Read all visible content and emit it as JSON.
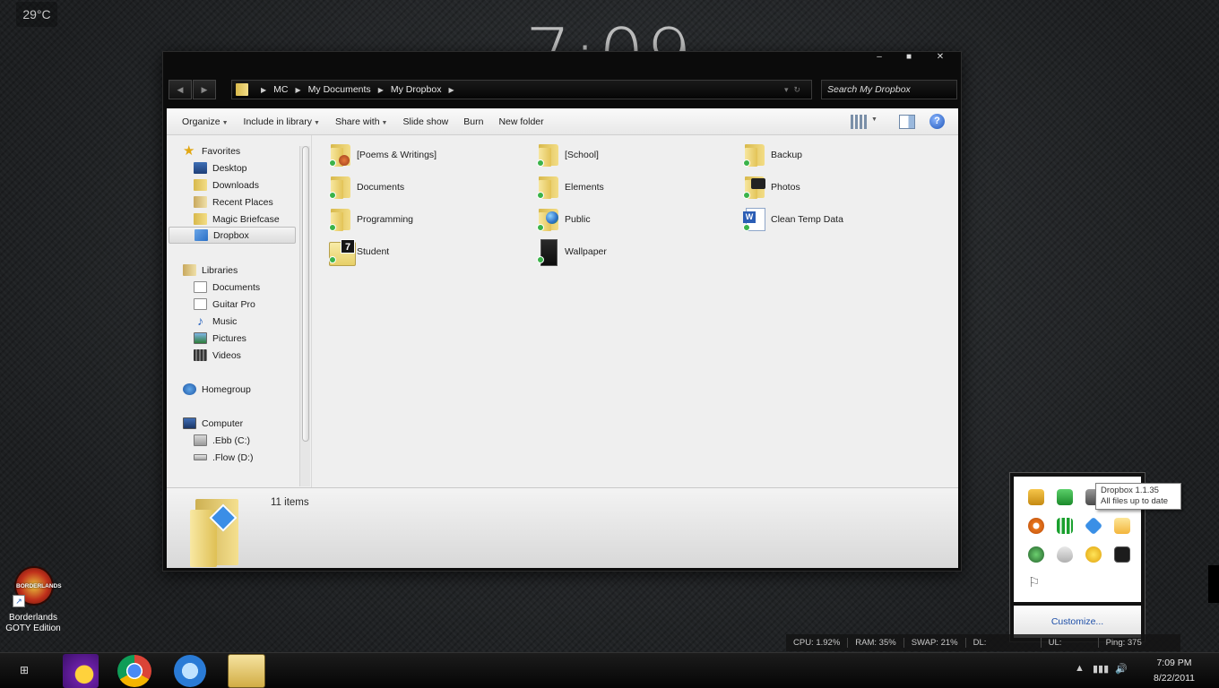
{
  "desktop": {
    "weather": "29°C",
    "clock": "7:09",
    "icon": {
      "label_line1": "Borderlands",
      "label_line2": "GOTY Edition",
      "logo_text": "BORDERLANDS"
    }
  },
  "window": {
    "buttons": {
      "minimize": "–",
      "maximize": "■",
      "close": "✕"
    },
    "nav": {
      "back": "◀",
      "forward": "▶"
    },
    "breadcrumb": [
      "MC",
      "My Documents",
      "My Dropbox"
    ],
    "search_placeholder": "Search My Dropbox",
    "toolbar": {
      "organize": "Organize",
      "include_in_library": "Include in library",
      "share_with": "Share with",
      "slide_show": "Slide show",
      "burn": "Burn",
      "new_folder": "New folder",
      "help": "?"
    },
    "sidebar": {
      "favorites": {
        "header": "Favorites",
        "items": [
          "Desktop",
          "Downloads",
          "Recent Places",
          "Magic Briefcase",
          "Dropbox"
        ]
      },
      "libraries": {
        "header": "Libraries",
        "items": [
          "Documents",
          "Guitar Pro",
          "Music",
          "Pictures",
          "Videos"
        ]
      },
      "homegroup": "Homegroup",
      "computer": {
        "header": "Computer",
        "items": [
          ".Ebb (C:)",
          ".Flow (D:)"
        ]
      }
    },
    "files": [
      "[Poems & Writings]",
      "[School]",
      "Backup",
      "Documents",
      "Elements",
      "Photos",
      "Programming",
      "Public",
      "Clean Temp Data",
      "Student",
      "Wallpaper"
    ],
    "student_badge": "7",
    "word_badge": "W",
    "details": {
      "item_count": "11 items"
    }
  },
  "tray": {
    "tooltip": {
      "title": "Dropbox 1.1.35",
      "status": "All files up to date"
    },
    "customize": "Customize..."
  },
  "stats": {
    "cpu": "CPU:  1.92%",
    "ram": "RAM:  35%",
    "swap": "SWAP:  21%",
    "dl": "DL:",
    "ul": "UL:",
    "ping": "Ping:  375"
  },
  "taskbar": {
    "start": "⊞",
    "time": "7:09 PM",
    "date": "8/22/2011"
  },
  "colors": {
    "accent": "#1e4fa8",
    "check": "#3bb34a",
    "folder": "#e3c356"
  }
}
